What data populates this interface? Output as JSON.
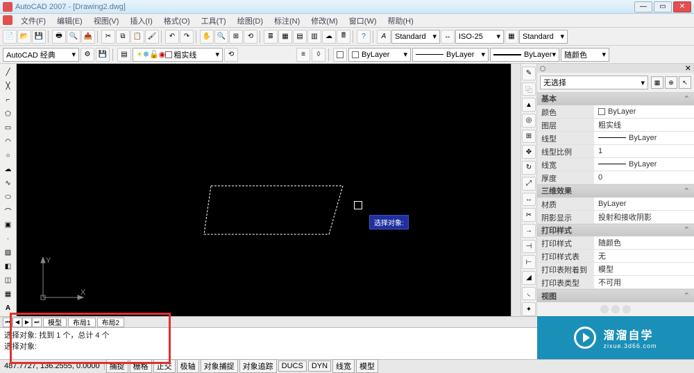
{
  "title": "AutoCAD 2007 - [Drawing2.dwg]",
  "menus": [
    "文件(F)",
    "编辑(E)",
    "视图(V)",
    "插入(I)",
    "格式(O)",
    "工具(T)",
    "绘图(D)",
    "标注(N)",
    "修改(M)",
    "窗口(W)",
    "帮助(H)"
  ],
  "styles_row": {
    "text_style": "Standard",
    "dim_style": "ISO-25",
    "table_style": "Standard"
  },
  "workspace": "AutoCAD 经典",
  "layer_row": {
    "current": "粗实线"
  },
  "layer_props": {
    "layer": "ByLayer",
    "linetype": "ByLayer",
    "lineweight": "ByLayer",
    "plotcolor": "随颜色"
  },
  "left_tools": [
    "line-icon",
    "xline-icon",
    "pline-icon",
    "polygon-icon",
    "rect-icon",
    "arc-icon",
    "circle-icon",
    "revcloud-icon",
    "spline-icon",
    "ellipse-icon",
    "ellipsearc-icon",
    "block-icon",
    "point-icon",
    "hatch-icon",
    "gradient-icon",
    "region-icon",
    "table-icon",
    "text-icon"
  ],
  "right_tools": [
    "erase-icon",
    "copy-icon",
    "mirror-icon",
    "offset-icon",
    "array-icon",
    "move-icon",
    "rotate-icon",
    "scale-icon",
    "stretch-icon",
    "trim-icon",
    "extend-icon",
    "break-icon",
    "join-icon",
    "chamfer-icon",
    "fillet-icon",
    "explode-icon"
  ],
  "tooltip": "选择对象:",
  "props_panel": {
    "pulldown": "无选择",
    "sections": {
      "general": {
        "title": "基本",
        "rows": [
          {
            "label": "颜色",
            "value": "ByLayer",
            "swatch": true
          },
          {
            "label": "图层",
            "value": "粗实线"
          },
          {
            "label": "线型",
            "value": "ByLayer",
            "line": true
          },
          {
            "label": "线型比例",
            "value": "1"
          },
          {
            "label": "线宽",
            "value": "ByLayer",
            "line": true
          },
          {
            "label": "厚度",
            "value": "0"
          }
        ]
      },
      "threeD": {
        "title": "三维效果",
        "rows": [
          {
            "label": "材质",
            "value": "ByLayer"
          },
          {
            "label": "阴影显示",
            "value": "投射和接收阴影"
          }
        ]
      },
      "plot": {
        "title": "打印样式",
        "rows": [
          {
            "label": "打印样式",
            "value": "随颜色"
          },
          {
            "label": "打印样式表",
            "value": "无"
          },
          {
            "label": "打印表附着到",
            "value": "模型"
          },
          {
            "label": "打印表类型",
            "value": "不可用"
          }
        ]
      },
      "view": {
        "title": "视图"
      }
    }
  },
  "tabs": [
    "模型",
    "布局1",
    "布局2"
  ],
  "command": {
    "line1": "选择对象: 找到 1 个，总计 4 个",
    "line2": "选择对象:"
  },
  "status": {
    "coords": "487.7727, 136.2555, 0.0000",
    "toggles": [
      "捕捉",
      "栅格",
      "正交",
      "极轴",
      "对象捕捉",
      "对象追踪",
      "DUCS",
      "DYN",
      "线宽",
      "模型"
    ]
  },
  "watermark": {
    "brand": "溜溜自学",
    "url": "zixue.3d66.com"
  }
}
